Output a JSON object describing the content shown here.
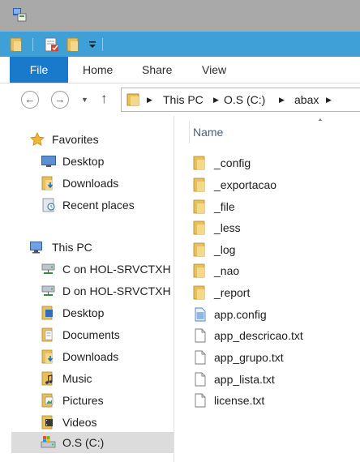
{
  "ribbon": {
    "tabs": [
      {
        "label": "File"
      },
      {
        "label": "Home"
      },
      {
        "label": "Share"
      },
      {
        "label": "View"
      }
    ]
  },
  "address": {
    "crumbs": [
      "This PC",
      "O.S (C:)",
      "abax"
    ]
  },
  "nav_pane": {
    "favorites_label": "Favorites",
    "favorites": [
      {
        "label": "Desktop",
        "icon": "desktop-icon"
      },
      {
        "label": "Downloads",
        "icon": "downloads-icon"
      },
      {
        "label": "Recent places",
        "icon": "recent-places-icon"
      }
    ],
    "this_pc_label": "This PC",
    "this_pc": [
      {
        "label": "C on HOL-SRVCTXH",
        "icon": "network-drive-icon"
      },
      {
        "label": "D on HOL-SRVCTXH",
        "icon": "network-drive-icon"
      },
      {
        "label": "Desktop",
        "icon": "desktop-folder-icon"
      },
      {
        "label": "Documents",
        "icon": "documents-icon"
      },
      {
        "label": "Downloads",
        "icon": "downloads-icon"
      },
      {
        "label": "Music",
        "icon": "music-icon"
      },
      {
        "label": "Pictures",
        "icon": "pictures-icon"
      },
      {
        "label": "Videos",
        "icon": "videos-icon"
      },
      {
        "label": "O.S (C:)",
        "icon": "local-disk-icon",
        "selected": true
      }
    ]
  },
  "file_list": {
    "column_name": "Name",
    "items": [
      {
        "name": "_config",
        "type": "folder"
      },
      {
        "name": "_exportacao",
        "type": "folder"
      },
      {
        "name": "_file",
        "type": "folder"
      },
      {
        "name": "_less",
        "type": "folder"
      },
      {
        "name": "_log",
        "type": "folder"
      },
      {
        "name": "_nao",
        "type": "folder"
      },
      {
        "name": "_report",
        "type": "folder"
      },
      {
        "name": "app.config",
        "type": "config"
      },
      {
        "name": "app_descricao.txt",
        "type": "text"
      },
      {
        "name": "app_grupo.txt",
        "type": "text"
      },
      {
        "name": "app_lista.txt",
        "type": "text"
      },
      {
        "name": "license.txt",
        "type": "text"
      }
    ]
  },
  "colors": {
    "qat_bar": "#3fa0d8",
    "file_tab": "#1979ca",
    "selected_nav": "#dcdcdc",
    "folder_yellow": "#e8c05a",
    "header_text": "#4c607a"
  }
}
